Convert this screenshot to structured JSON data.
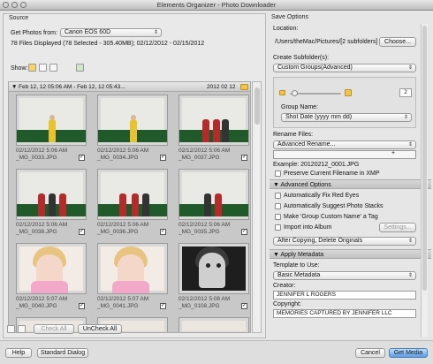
{
  "window": {
    "title": "Elements Organizer - Photo Downloader"
  },
  "source": {
    "section_title": "Source",
    "get_photos_label": "Get Photos from:",
    "device": "Canon EOS 60D",
    "summary": "78 Files Displayed (78 Selected - 305.40MB); 02/12/2012 - 02/15/2012",
    "show_label": "Show:",
    "group_header": "Feb 12, 12 05:06 AM - Feb 12, 12 05:43...",
    "group_date": "2012 02 12",
    "thumbnails": [
      {
        "date": "02/12/2012 5:06 AM",
        "name": "_MG_0033.JPG",
        "checked": "✓"
      },
      {
        "date": "02/12/2012 5:06 AM",
        "name": "_MG_0034.JPG",
        "checked": "✓"
      },
      {
        "date": "02/12/2012 5:06 AM",
        "name": "_MG_0037.JPG",
        "checked": "✓"
      },
      {
        "date": "02/12/2012 5:06 AM",
        "name": "_MG_0038.JPG",
        "checked": "✓"
      },
      {
        "date": "02/12/2012 5:06 AM",
        "name": "_MG_0036.JPG",
        "checked": "✓"
      },
      {
        "date": "02/12/2012 5:06 AM",
        "name": "_MG_0035.JPG",
        "checked": "✓"
      },
      {
        "date": "02/12/2012 5:07 AM",
        "name": "_MG_0040.JPG",
        "checked": "✓"
      },
      {
        "date": "02/12/2012 5:07 AM",
        "name": "_MG_0041.JPG",
        "checked": "✓"
      },
      {
        "date": "02/12/2012 5:08 AM",
        "name": "_MG_0108.JPG",
        "checked": "✓"
      }
    ],
    "check_all": "Check All",
    "uncheck_all": "UnCheck All"
  },
  "save": {
    "section_title": "Save Options",
    "location_label": "Location:",
    "location_value": "/Users/theMac/Pictures/[2 subfolders]",
    "choose_button": "Choose...",
    "create_subfolders_label": "Create Subfolder(s):",
    "create_subfolders_value": "Custom Groups(Advanced)",
    "slider_count": "2",
    "group_name_label": "Group Name:",
    "group_name_value": "Shot Date (yyyy mm dd)",
    "rename_label": "Rename Files:",
    "rename_value": "Advanced Rename...",
    "plus": "+",
    "example": "Example: 20120212_0001.JPG",
    "preserve_label": "Preserve Current Filename in XMP"
  },
  "advanced": {
    "title": "Advanced Options",
    "fix_red_eyes": "Automatically Fix Red Eyes",
    "suggest_stacks": "Automatically Suggest Photo Stacks",
    "group_tag": "Make 'Group Custom Name' a Tag",
    "import_album": "Import into Album",
    "settings_button": "Settings...",
    "after_copy_value": "After Copying, Delete Originals"
  },
  "metadata": {
    "title": "Apply Metadata",
    "template_label": "Template to Use:",
    "template_value": "Basic Metadata",
    "creator_label": "Creator:",
    "creator_value": "JENNIFER L ROGERS",
    "copyright_label": "Copyright:",
    "copyright_value": "MEMORIES CAPTURED BY JENNIFER LLC"
  },
  "footer": {
    "help": "Help",
    "standard_dialog": "Standard Dialog",
    "cancel": "Cancel",
    "get_media": "Get Media"
  }
}
